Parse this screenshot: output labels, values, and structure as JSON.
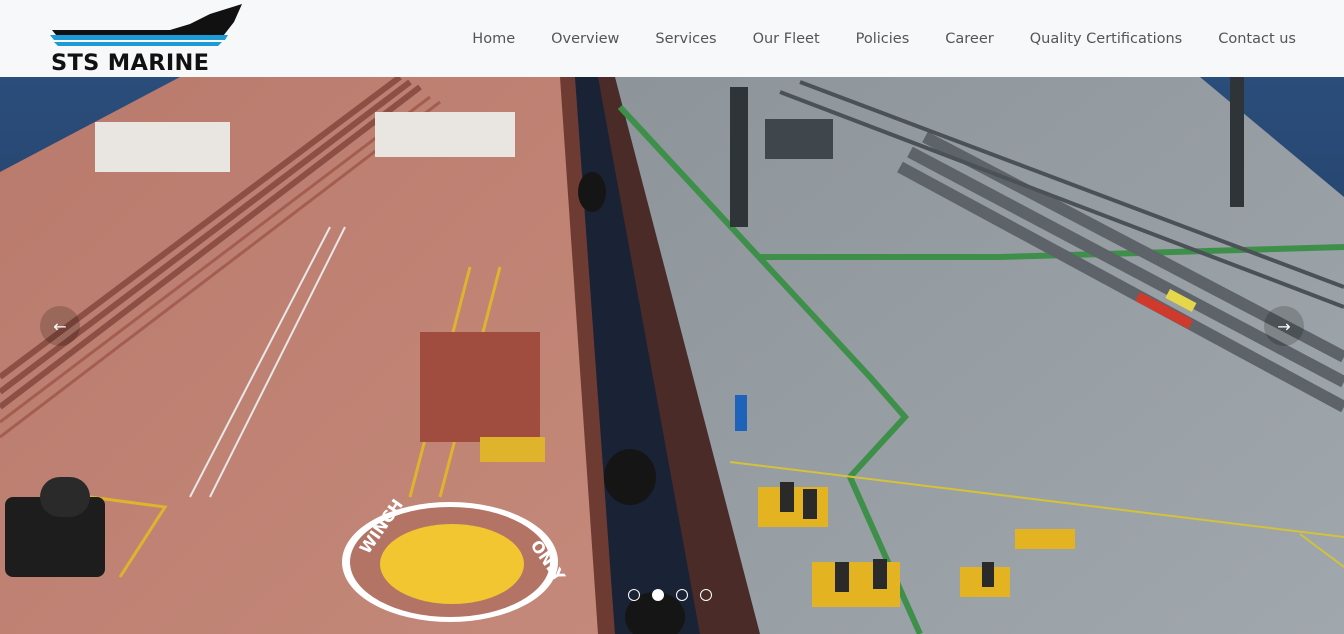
{
  "brand": {
    "name": "STS MARINE",
    "colors": {
      "ship": "#111111",
      "stripe": "#1e9ad6",
      "text": "#111111"
    }
  },
  "nav": {
    "items": [
      {
        "label": "Home"
      },
      {
        "label": "Overview"
      },
      {
        "label": "Services"
      },
      {
        "label": "Our Fleet"
      },
      {
        "label": "Policies"
      },
      {
        "label": "Career"
      },
      {
        "label": "Quality Certifications"
      },
      {
        "label": "Contact us"
      }
    ]
  },
  "hero": {
    "image": "two-tankers-ship-to-ship-transfer",
    "deck_text_left": "WINCH",
    "deck_text_right": "ONLY",
    "prev_icon": "chevron-left-icon",
    "next_icon": "chevron-right-icon",
    "prev_glyph": "←",
    "next_glyph": "→",
    "slides": 4,
    "active_slide": 2
  }
}
